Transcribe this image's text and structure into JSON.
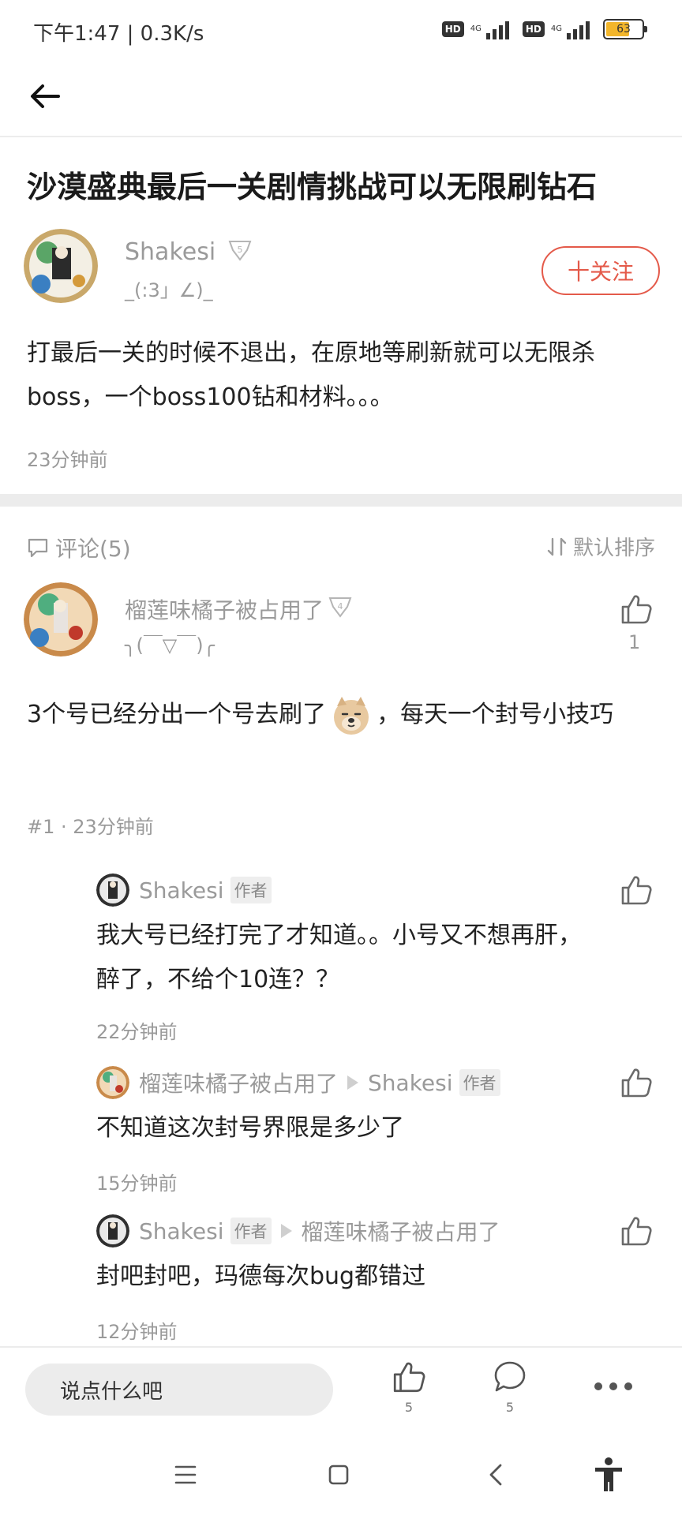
{
  "status_bar": {
    "time": "下午1:47 | 0.3K/s",
    "hd1": "HD",
    "net1": "4G",
    "hd2": "HD",
    "net2": "4G",
    "battery": "63"
  },
  "post": {
    "title": "沙漠盛典最后一关剧情挑战可以无限刷钻石",
    "author": {
      "name": "Shakesi",
      "level_badge": "5",
      "signature": "_(:3」∠)_"
    },
    "follow_label": "十关注",
    "body": "打最后一关的时候不退出，在原地等刷新就可以无限杀boss，一个boss100钻和材料。。。",
    "time": "23分钟前"
  },
  "comments_header": {
    "label": "评论(5)",
    "sort_label": "默认排序"
  },
  "comment1": {
    "name": "榴莲味橘子被占用了",
    "level_badge": "4",
    "signature": "╮(￣▽￣)╭",
    "like_count": "1",
    "body_before": "3个号已经分出一个号去刷了",
    "body_after": "，每天一个封号小技巧",
    "meta": "#1 · 23分钟前"
  },
  "replies": [
    {
      "name": "Shakesi",
      "author_tag": "作者",
      "body": "我大号已经打完了才知道。。小号又不想再肝，醉了，不给个10连？？",
      "time": "22分钟前"
    },
    {
      "name": "榴莲味橘子被占用了",
      "reply_to": "Shakesi",
      "author_tag": "作者",
      "body": "不知道这次封号界限是多少了",
      "time": "15分钟前"
    },
    {
      "name": "Shakesi",
      "author_tag": "作者",
      "reply_to": "榴莲味橘子被占用了",
      "body": "封吧封吧，玛德每次bug都错过",
      "time": "12分钟前"
    }
  ],
  "bottom_bar": {
    "input_placeholder": "说点什么吧",
    "like_count": "5",
    "comment_count": "5"
  },
  "colors": {
    "accent": "#e45a4a",
    "muted_text": "#9a9a9a",
    "divider": "#ececec"
  },
  "icons": [
    "back-arrow-icon",
    "comment-icon",
    "sort-icon",
    "thumbs-up-icon",
    "more-icon",
    "menu-icon",
    "home-icon",
    "back-nav-icon",
    "accessibility-icon"
  ]
}
